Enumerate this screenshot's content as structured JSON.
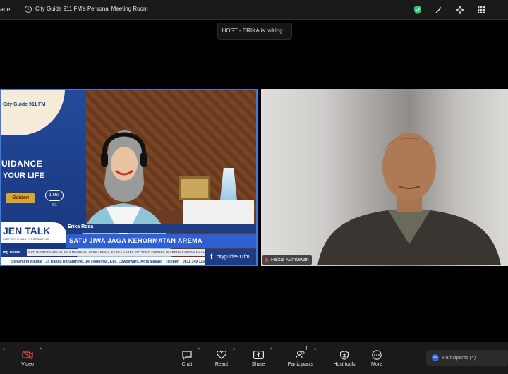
{
  "topbar": {
    "left_label": "ace",
    "title": "City Guide 911 FM's Personal Meeting Room"
  },
  "talking_indicator": "HOST - ERIKA is talking...",
  "left_video": {
    "brand": "City Guide 911 FM",
    "slogan_line1": "UIDANCE",
    "slogan_line2": "YOUR LIFE",
    "golden_badge": "Golden",
    "bubble": "1 Mei '91",
    "show_title": "JEN TALK",
    "show_subtitle": "INSPIRING AND INFORMATIVE",
    "host_name": "Erika Rosa",
    "headline": "SATU JIWA JAGA KEHORMATAN AREMA",
    "breaking_label": "ing News",
    "ticker": "SATU KEBERSAMAAN, NGA MBUHLAH AREK AREMA, KAREA KAREK SETTONG DHEREK DI AREMA KARENA MALANG",
    "address": "Streaming Alamat : Jl. Danau Ranaran No. 14 Tlogomas, Kec. Lowokwaru, Kota Malang | Telepon : 0811 349 125",
    "facebook_handle": "cityguide911fm"
  },
  "right_video": {
    "participant_name": "Faizal Kurniawan"
  },
  "toolbar": {
    "video": "Video",
    "chat": "Chat",
    "react": "React",
    "share": "Share",
    "participants": "Participants",
    "participants_count": "4",
    "host_tools": "Host tools",
    "more": "More"
  },
  "participants_panel": {
    "label": "Participants (4)",
    "zoom_badge": "zm"
  },
  "colors": {
    "brand_blue": "#1c3d86",
    "active_speaker_border": "#3b7bdc",
    "shield_green": "#2ecc71",
    "video_off_red": "#e24b4b"
  }
}
